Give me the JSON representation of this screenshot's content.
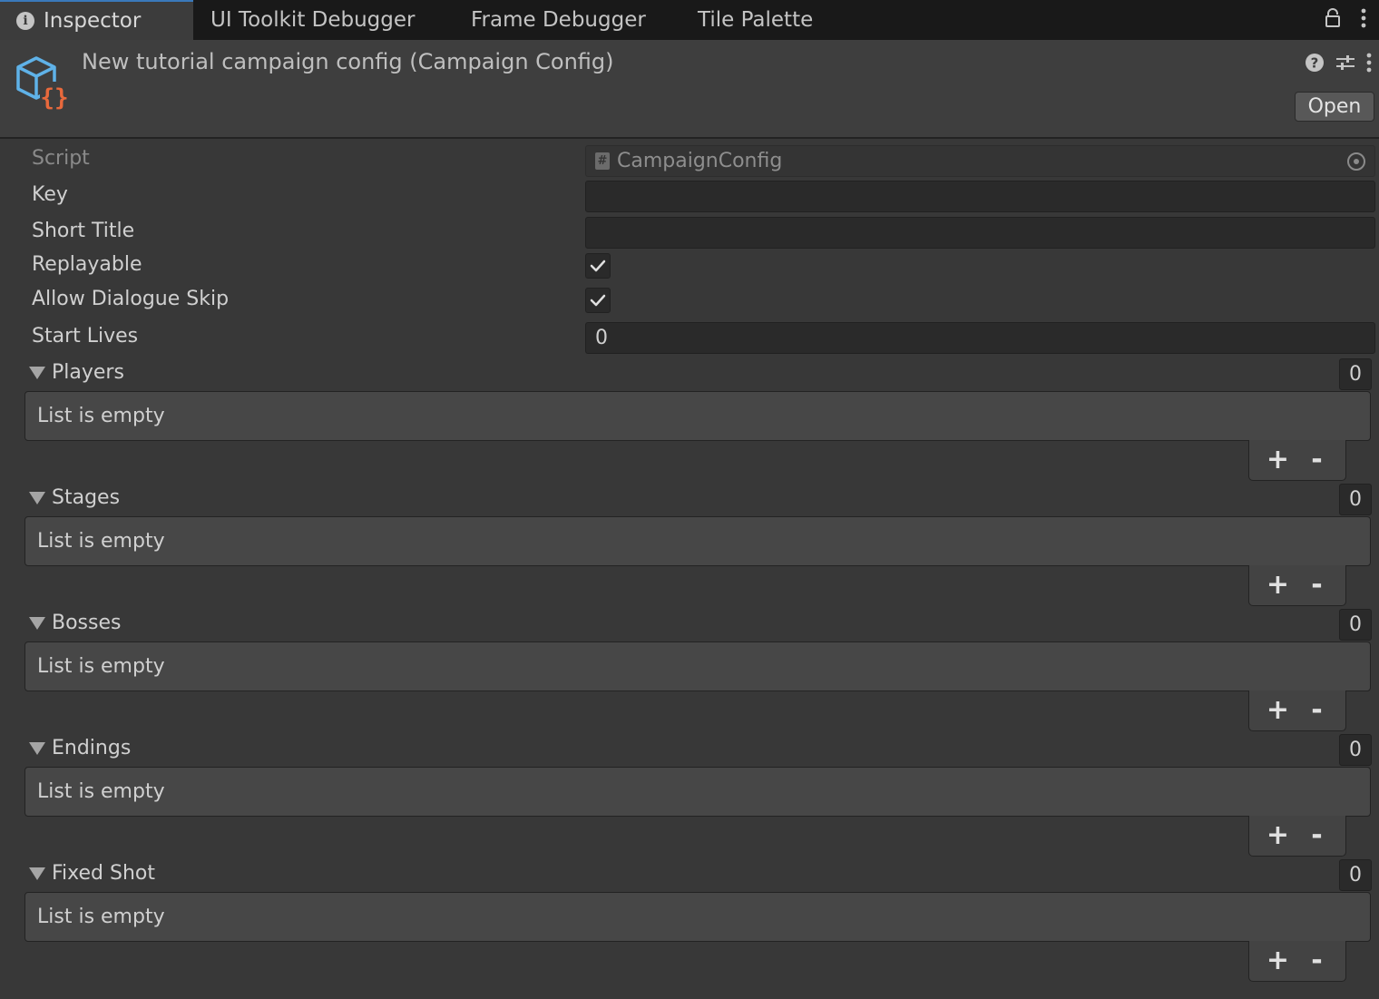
{
  "tabs": [
    {
      "label": "Inspector",
      "icon": "info-icon",
      "active": true
    },
    {
      "label": "UI Toolkit Debugger",
      "active": false
    },
    {
      "label": "Frame Debugger",
      "active": false
    },
    {
      "label": "Tile Palette",
      "active": false
    }
  ],
  "header": {
    "title": "New tutorial campaign config (Campaign Config)",
    "open_label": "Open",
    "icon": "scriptable-object-icon"
  },
  "properties": {
    "script": {
      "label": "Script",
      "value": "CampaignConfig",
      "icon": "script-icon"
    },
    "key": {
      "label": "Key",
      "value": ""
    },
    "short_title": {
      "label": "Short Title",
      "value": ""
    },
    "replayable": {
      "label": "Replayable",
      "checked": true
    },
    "allow_dialogue_skip": {
      "label": "Allow Dialogue Skip",
      "checked": true
    },
    "start_lives": {
      "label": "Start Lives",
      "value": "0"
    }
  },
  "lists": [
    {
      "label": "Players",
      "size": "0",
      "empty_text": "List is empty",
      "add": "+",
      "remove": "-"
    },
    {
      "label": "Stages",
      "size": "0",
      "empty_text": "List is empty",
      "add": "+",
      "remove": "-"
    },
    {
      "label": "Bosses",
      "size": "0",
      "empty_text": "List is empty",
      "add": "+",
      "remove": "-"
    },
    {
      "label": "Endings",
      "size": "0",
      "empty_text": "List is empty",
      "add": "+",
      "remove": "-"
    },
    {
      "label": "Fixed Shot",
      "size": "0",
      "empty_text": "List is empty",
      "add": "+",
      "remove": "-"
    }
  ],
  "colors": {
    "accent_tab": "#3a79bb",
    "icon_blue": "#5fb2e8",
    "icon_orange": "#e8693c"
  }
}
